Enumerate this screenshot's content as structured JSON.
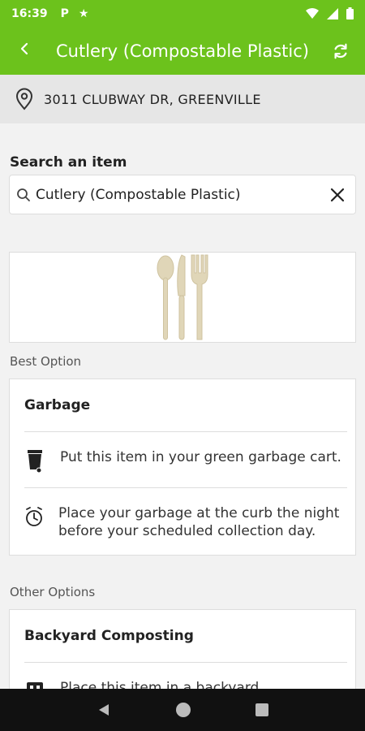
{
  "status_bar": {
    "time": "16:39",
    "icons": [
      "parking-icon",
      "star-icon",
      "wifi-icon",
      "battery-icon"
    ],
    "p_glyph": "P"
  },
  "app_bar": {
    "title": "Cutlery (Compostable Plastic)",
    "background_color": "#6cc21c"
  },
  "address": {
    "text": "3011 CLUBWAY DR, GREENVILLE"
  },
  "search": {
    "label": "Search an item",
    "value": "Cutlery (Compostable Plastic)"
  },
  "best_option": {
    "section_label": "Best Option",
    "title": "Garbage",
    "rows": [
      {
        "icon": "garbage-cart-icon",
        "text": "Put this item in your green garbage cart."
      },
      {
        "icon": "alarm-clock-icon",
        "text": "Place your garbage at the curb the night before your scheduled collection day."
      }
    ]
  },
  "other_options": {
    "section_label": "Other Options",
    "title": "Backyard Composting",
    "rows": [
      {
        "icon": "compost-bin-icon",
        "text": "Place this item in a backyard"
      }
    ]
  }
}
